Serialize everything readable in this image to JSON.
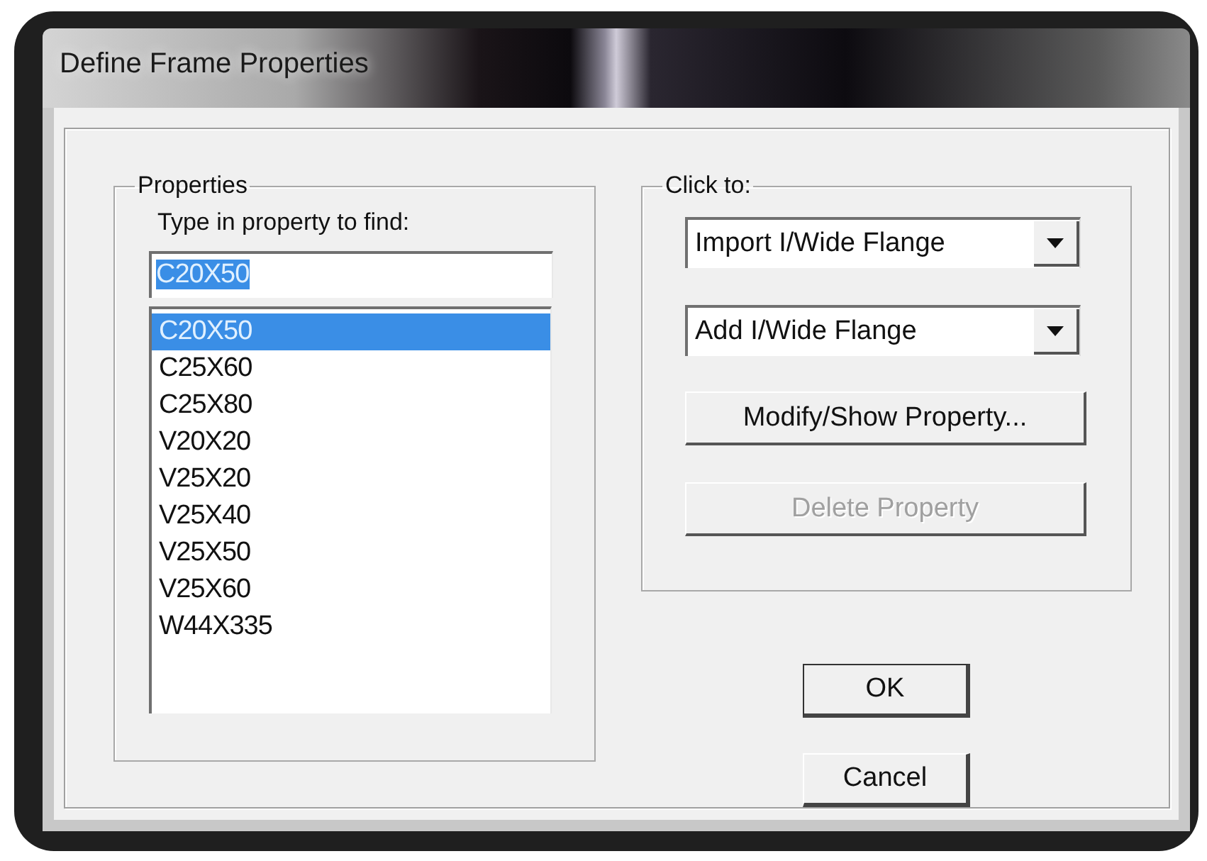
{
  "window": {
    "title": "Define Frame Properties"
  },
  "properties": {
    "label": "Properties",
    "find_label": "Type in property to find:",
    "find_value": "C20X50",
    "find_value_highlighted": true,
    "items": [
      {
        "label": "C20X50",
        "selected": true
      },
      {
        "label": "C25X60",
        "selected": false
      },
      {
        "label": "C25X80",
        "selected": false
      },
      {
        "label": "V20X20",
        "selected": false
      },
      {
        "label": "V25X20",
        "selected": false
      },
      {
        "label": "V25X40",
        "selected": false
      },
      {
        "label": "V25X50",
        "selected": false
      },
      {
        "label": "V25X60",
        "selected": false
      },
      {
        "label": "W44X335",
        "selected": false
      }
    ]
  },
  "actions": {
    "label": "Click to:",
    "dropdowns": [
      {
        "value": "Import I/Wide Flange"
      },
      {
        "value": "Add I/Wide Flange"
      }
    ],
    "buttons": [
      {
        "label": "Modify/Show Property...",
        "disabled": false
      },
      {
        "label": "Delete Property",
        "disabled": true
      }
    ]
  },
  "dialog_buttons": [
    {
      "label": "OK",
      "default": true
    },
    {
      "label": "Cancel",
      "default": false
    }
  ]
}
